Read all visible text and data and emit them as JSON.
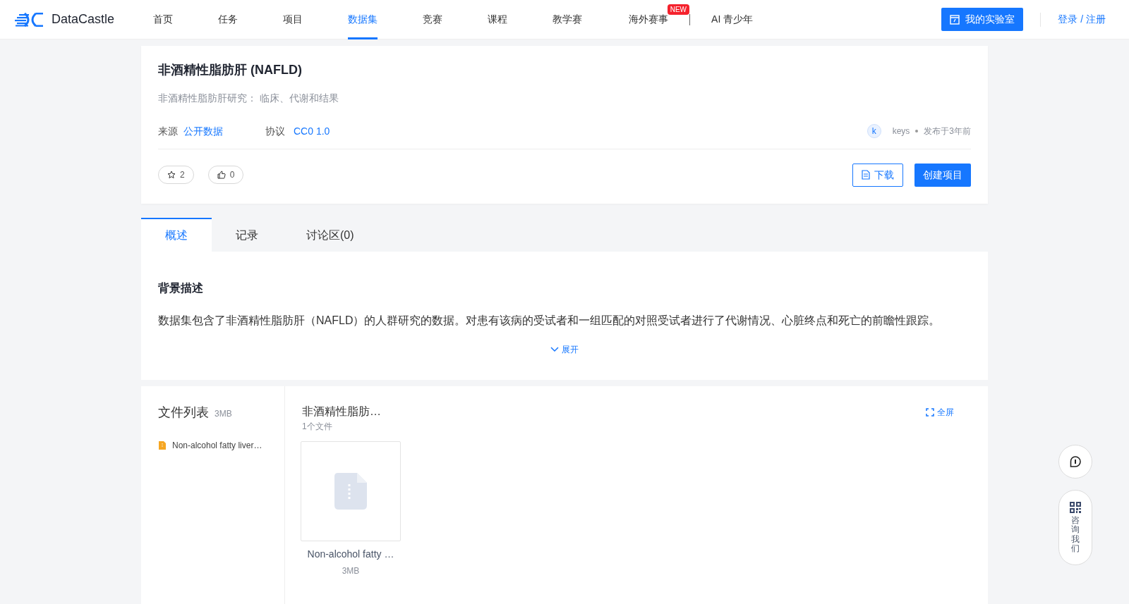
{
  "brand": {
    "name": "DataCastle"
  },
  "nav": [
    {
      "label": "首页",
      "selected": false
    },
    {
      "label": "任务",
      "selected": false
    },
    {
      "label": "项目",
      "selected": false
    },
    {
      "label": "数据集",
      "selected": true
    },
    {
      "label": "竞赛",
      "selected": false
    },
    {
      "label": "课程",
      "selected": false
    },
    {
      "label": "教学赛",
      "selected": false
    },
    {
      "label": "海外赛事",
      "selected": false,
      "badge": "NEW"
    },
    {
      "label": "AI 青少年",
      "selected": false
    }
  ],
  "lab_button": "我的实验室",
  "login": "登录 / 注册",
  "dataset": {
    "title": "非酒精性脂肪肝 (NAFLD)",
    "subtitle": "非酒精性脂肪肝研究： 临床、代谢和结果",
    "source_label": "来源",
    "source": "公开数据",
    "license_label": "协议",
    "license": "CC0 1.0",
    "author_initial": "k",
    "author": "keys",
    "published": "发布于3年前",
    "stars": "2",
    "likes": "0",
    "download": "下载",
    "create": "创建项目"
  },
  "tabs": [
    {
      "label": "概述",
      "selected": true
    },
    {
      "label": "记录",
      "selected": false
    },
    {
      "label": "讨论区(0)",
      "selected": false
    }
  ],
  "overview": {
    "heading": "背景描述",
    "text": "数据集包含了非酒精性脂肪肝（NAFLD）的人群研究的数据。对患有该病的受试者和一组匹配的对照受试者进行了代谢情况、心脏终点和死亡的前瞻性跟踪。",
    "expand": "展开"
  },
  "files": {
    "title": "文件列表",
    "size": "3MB",
    "items": [
      {
        "name": "Non-alcohol fatty liver…"
      }
    ],
    "folder": "非酒精性脂肪…",
    "count": "1个文件",
    "fullscreen": "全屏",
    "cards": [
      {
        "name": "Non-alcohol fatty …",
        "size": "3MB"
      }
    ]
  },
  "float": {
    "consult": "咨询我们"
  }
}
